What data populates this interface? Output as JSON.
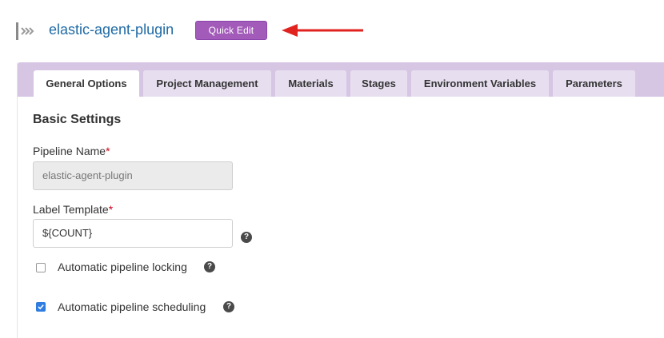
{
  "header": {
    "pipeline_name": "elastic-agent-plugin",
    "quick_edit_label": "Quick Edit"
  },
  "tabs": [
    {
      "label": "General Options",
      "active": true
    },
    {
      "label": "Project Management",
      "active": false
    },
    {
      "label": "Materials",
      "active": false
    },
    {
      "label": "Stages",
      "active": false
    },
    {
      "label": "Environment Variables",
      "active": false
    },
    {
      "label": "Parameters",
      "active": false
    }
  ],
  "basic_settings": {
    "title": "Basic Settings",
    "pipeline_name_label": "Pipeline Name",
    "pipeline_name_value": "elastic-agent-plugin",
    "label_template_label": "Label Template",
    "label_template_value": "${COUNT}",
    "required_marker": "*"
  },
  "options": [
    {
      "label": "Automatic pipeline locking",
      "checked": false
    },
    {
      "label": "Automatic pipeline scheduling",
      "checked": true
    }
  ],
  "colors": {
    "accent": "#a25bb9",
    "tabbar": "#d6c6e4",
    "link": "#1f6aa5",
    "arrow": "#e0231f",
    "checkbox": "#2f7de1"
  }
}
